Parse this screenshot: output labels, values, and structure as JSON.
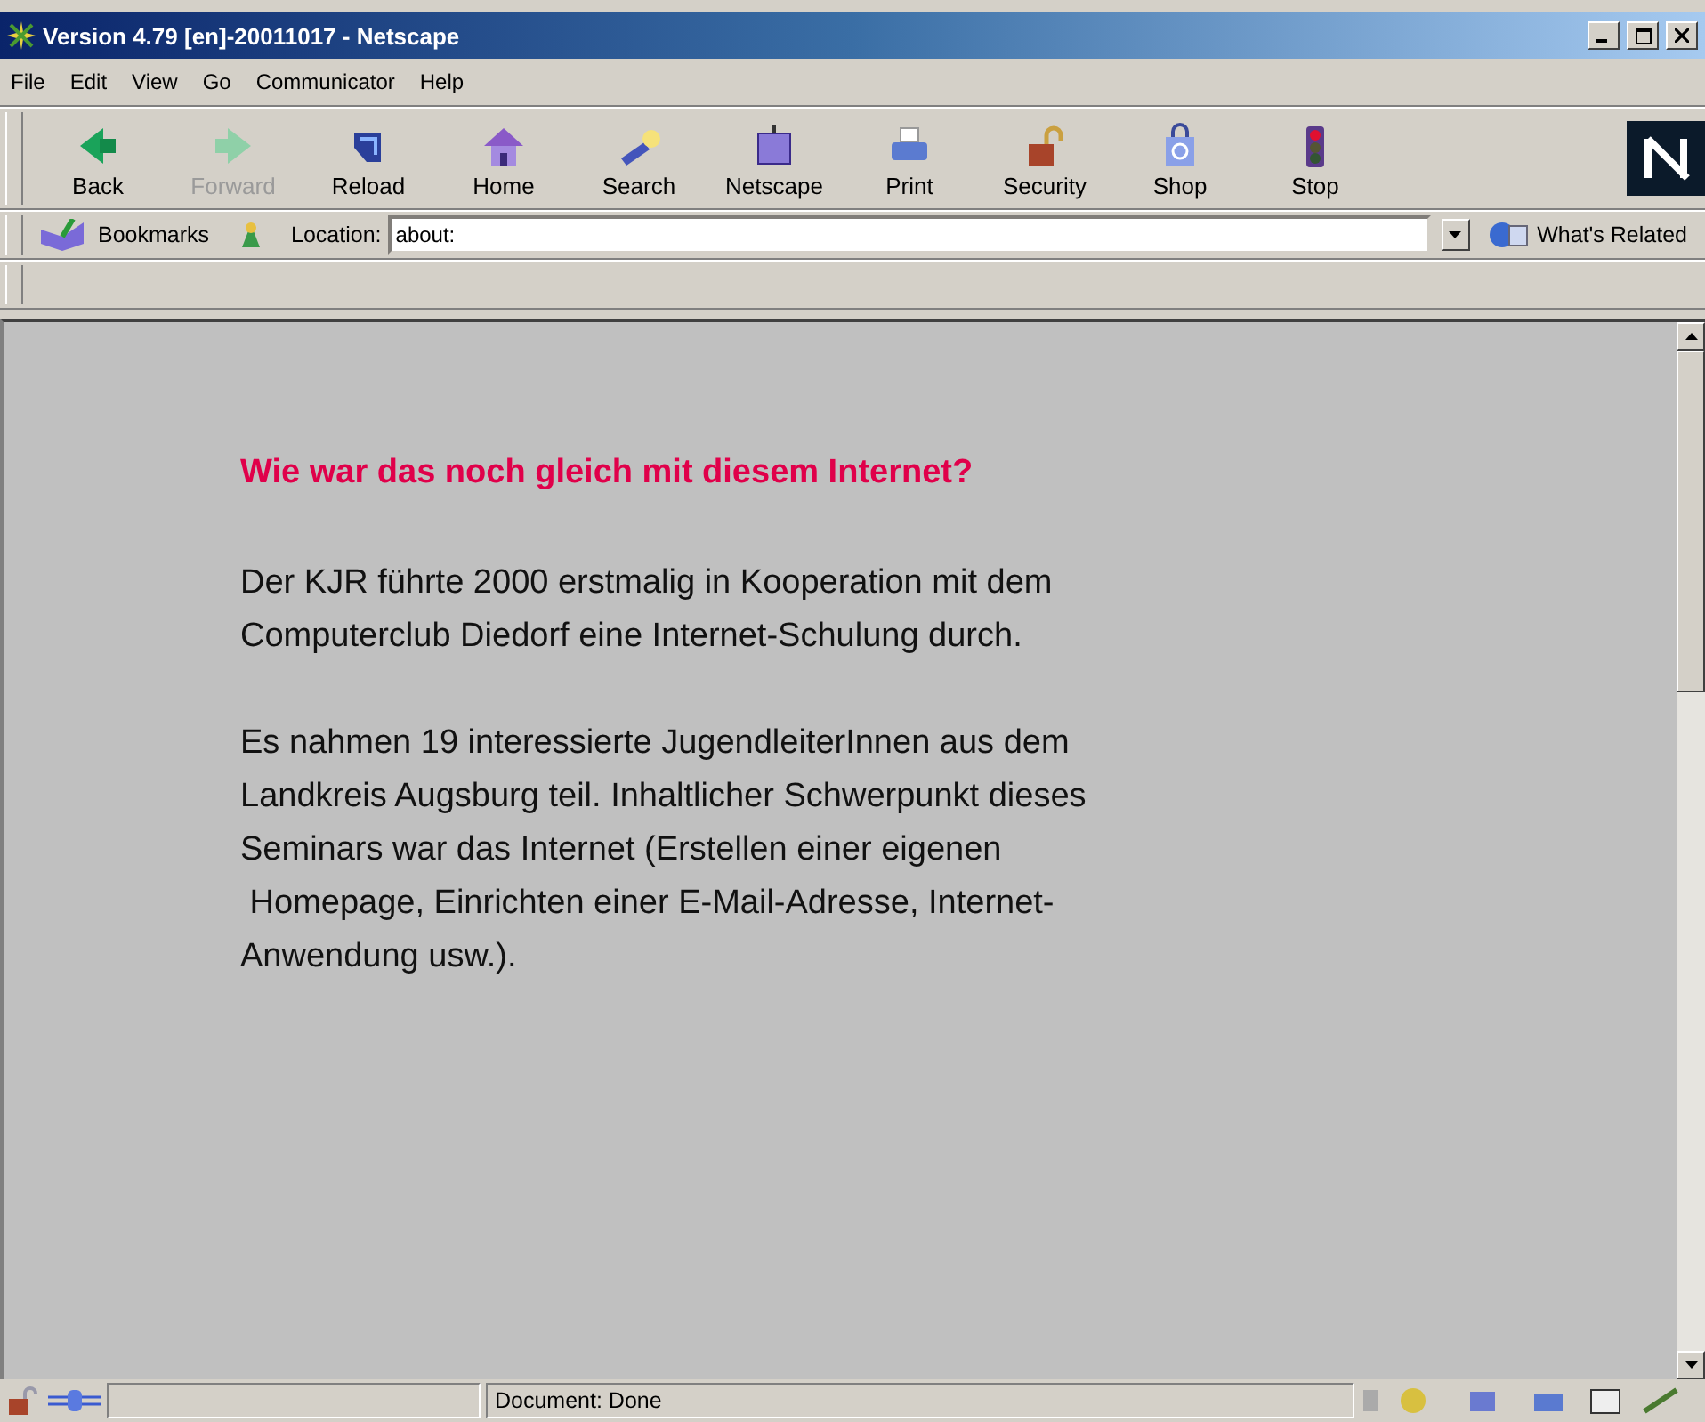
{
  "window": {
    "title": "Version 4.79 [en]-20011017 - Netscape"
  },
  "menu": [
    "File",
    "Edit",
    "View",
    "Go",
    "Communicator",
    "Help"
  ],
  "toolbar": [
    {
      "label": "Back",
      "kind": "back",
      "disabled": false
    },
    {
      "label": "Forward",
      "kind": "forward",
      "disabled": true
    },
    {
      "label": "Reload",
      "kind": "reload",
      "disabled": false
    },
    {
      "label": "Home",
      "kind": "home",
      "disabled": false
    },
    {
      "label": "Search",
      "kind": "search",
      "disabled": false
    },
    {
      "label": "Netscape",
      "kind": "my",
      "disabled": false
    },
    {
      "label": "Print",
      "kind": "print",
      "disabled": false
    },
    {
      "label": "Security",
      "kind": "security",
      "disabled": false
    },
    {
      "label": "Shop",
      "kind": "shop",
      "disabled": false
    },
    {
      "label": "Stop",
      "kind": "stop",
      "disabled": false
    }
  ],
  "location_bar": {
    "bookmarks": "Bookmarks",
    "location_label": "Location:",
    "url": "about:",
    "related": "What's Related"
  },
  "content": {
    "heading": "Wie war das noch gleich mit diesem Internet?",
    "paragraphs": [
      [
        "Der KJR führte 2000 erstmalig in Kooperation mit dem",
        "Computerclub Diedorf eine Internet-Schulung durch."
      ],
      [
        "Es nahmen 19 interessierte JugendleiterInnen aus dem",
        "Landkreis Augsburg teil. Inhaltlicher Schwerpunkt dieses",
        "Seminars war das Internet (Erstellen einer eigenen",
        " Homepage, Einrichten einer E-Mail-Adresse, Internet-",
        "Anwendung usw.)."
      ]
    ]
  },
  "status_bar": {
    "text": "Document: Done"
  }
}
